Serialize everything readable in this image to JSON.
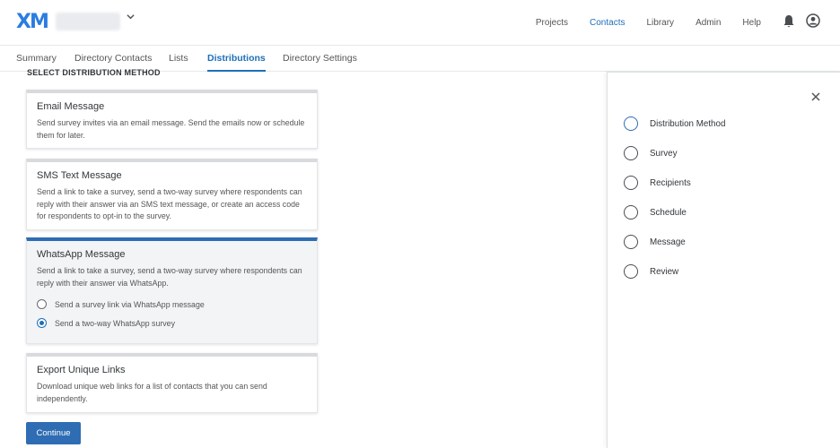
{
  "header": {
    "logo": "XM",
    "project_name": "",
    "nav": [
      "Projects",
      "Contacts",
      "Library",
      "Admin",
      "Help"
    ],
    "active_nav": "Contacts",
    "accent_color": "#1d6fb8"
  },
  "tabs": [
    "Summary",
    "Directory Contacts",
    "Lists",
    "Distributions",
    "Directory Settings"
  ],
  "active_tab": "Distributions",
  "main": {
    "section_title": "SELECT DISTRIBUTION METHOD",
    "cards": [
      {
        "title": "Email Message",
        "desc": "Send survey invites via an email message. Send the emails now or schedule them for later."
      },
      {
        "title": "SMS Text Message",
        "desc": "Send a link to take a survey, send a two-way survey where respondents can reply with their answer via an SMS text message, or create an access code for respondents to opt-in to the survey."
      },
      {
        "title": "WhatsApp Message",
        "desc": "Send a link to take a survey, send a two-way survey where respondents can reply with their answer via WhatsApp.",
        "options": [
          {
            "label": "Send a survey link via WhatsApp message",
            "checked": false
          },
          {
            "label": "Send a two-way WhatsApp survey",
            "checked": true
          }
        ]
      },
      {
        "title": "Export Unique Links",
        "desc": "Download unique web links for a list of contacts that you can send independently."
      }
    ],
    "continue_label": "Continue"
  },
  "side_panel": {
    "steps": [
      "Distribution Method",
      "Survey",
      "Recipients",
      "Schedule",
      "Message",
      "Review"
    ],
    "current_step": "Distribution Method"
  },
  "icons": {
    "close": "close-icon",
    "bell": "bell-icon",
    "user": "user-icon",
    "chevron": "chevron-down-icon"
  }
}
